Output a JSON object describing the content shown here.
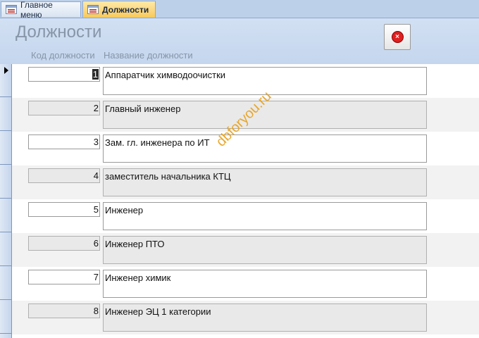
{
  "tabs": [
    {
      "label": "Главное меню",
      "active": false
    },
    {
      "label": "Должности",
      "active": true
    }
  ],
  "form": {
    "title": "Должности",
    "close_button_label": "×",
    "columns": {
      "code": "Код должности",
      "name": "Название должности"
    }
  },
  "records": [
    {
      "code": "1",
      "name": "Аппаратчик химводоочистки"
    },
    {
      "code": "2",
      "name": "Главный инженер"
    },
    {
      "code": "3",
      "name": "Зам. гл. инженера по ИТ"
    },
    {
      "code": "4",
      "name": "заместитель начальника КТЦ"
    },
    {
      "code": "5",
      "name": "Инженер"
    },
    {
      "code": "6",
      "name": "Инженер ПТО"
    },
    {
      "code": "7",
      "name": "Инженер химик"
    },
    {
      "code": "8",
      "name": "Инженер ЭЦ 1 категории"
    }
  ],
  "watermark": "dbforyou.ru",
  "colors": {
    "accent_tab": "#f7c95c",
    "header_bg": "#c4d6ee",
    "close_icon": "#e02020"
  }
}
